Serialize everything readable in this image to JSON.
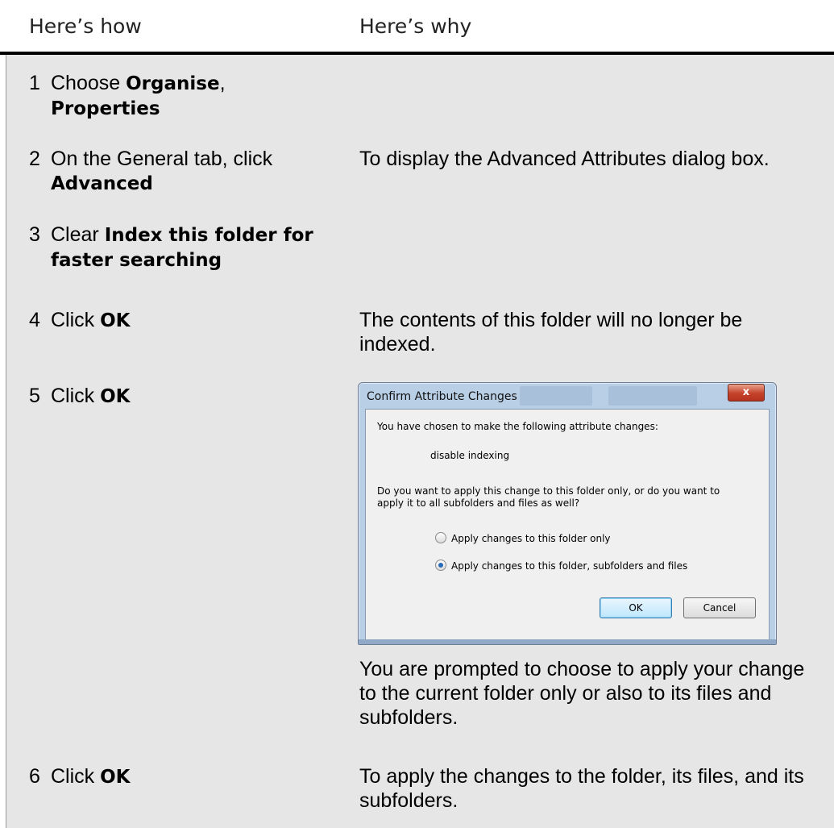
{
  "header": {
    "col_how": "Here’s how",
    "col_why": "Here’s why"
  },
  "steps": [
    {
      "num": "1",
      "pre": "Choose ",
      "b1": "Organise",
      "mid": ",",
      "b2": "Properties",
      "why": ""
    },
    {
      "num": "2",
      "pre": "On the General tab, click",
      "b1": "Advanced",
      "why": "To display the Advanced Attributes dialog box."
    },
    {
      "num": "3",
      "pre": "Clear ",
      "b1": "Index this folder for faster searching",
      "why": ""
    },
    {
      "num": "4",
      "pre": "Click ",
      "b1": "OK",
      "why": "The contents of this folder will no longer be indexed."
    },
    {
      "num": "5",
      "pre": "Click ",
      "b1": "OK",
      "why": "You are prompted to choose to apply your change to the current folder only or also to its files and subfolders."
    },
    {
      "num": "6",
      "pre": "Click ",
      "b1": "OK",
      "why": "To apply the changes to the folder, its files, and its subfolders."
    }
  ],
  "dialog": {
    "title": "Confirm Attribute Changes",
    "close_label": "x",
    "intro": "You have chosen to make the following attribute changes:",
    "change": "disable indexing",
    "question_line1": "Do you want to apply this change to this folder only, or do you want to",
    "question_line2": "apply it to all subfolders and files as well?",
    "option1": "Apply changes to this folder only",
    "option2": "Apply changes to this folder, subfolders and files",
    "selected_option": 2,
    "ok_label": "OK",
    "cancel_label": "Cancel"
  }
}
